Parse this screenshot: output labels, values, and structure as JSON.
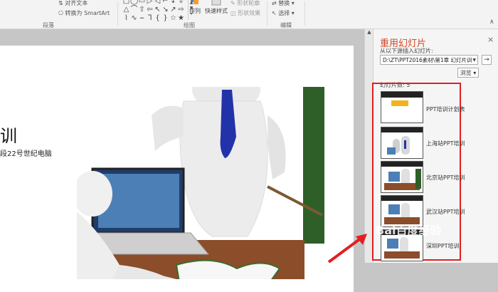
{
  "ribbon": {
    "align_text": "对齐文本",
    "convert_smartart": "转换为 SmartArt",
    "paragraph_group": "段落",
    "drawing_group": "绘图",
    "arrange_label": "排列",
    "quick_styles_label": "快速样式",
    "shape_outline": "形状轮廓",
    "shape_effects": "形状效果",
    "replace_label": "替换",
    "select_label": "选择",
    "editing_group": "编辑",
    "shapes": [
      "□",
      "◯",
      "▭",
      "▷",
      "◁",
      "⌐",
      "↓",
      "⇩",
      "△",
      "⌒",
      "⇧",
      "⇦",
      "↖",
      "↘",
      "↗",
      "⇨",
      "⌇",
      "∿",
      "⌢",
      "ᒣ",
      "{",
      "}",
      "☆",
      "★"
    ]
  },
  "slide": {
    "title": "训",
    "subtitle": "段22号世纪电脑"
  },
  "pane": {
    "title": "重用幻灯片",
    "close": "×",
    "instruction": "从以下源插入幻灯片:",
    "path_value": "D:\\ZT\\PPT2016素材\\第1章 幻灯片训",
    "go": "→",
    "browse_label": "浏览",
    "slide_count": "幻灯片数: 5",
    "slides": [
      {
        "label": "PPT培训计划表"
      },
      {
        "label": "上海站PPT培训"
      },
      {
        "label": "北京站PPT培训"
      },
      {
        "label": "武汉站PPT培训"
      },
      {
        "label": "深圳PPT培训"
      }
    ]
  },
  "watermark": "Bai百度经验",
  "colors": {
    "pane_title": "#d24726",
    "highlight_box": "#e02020",
    "arrow": "#e02020"
  }
}
